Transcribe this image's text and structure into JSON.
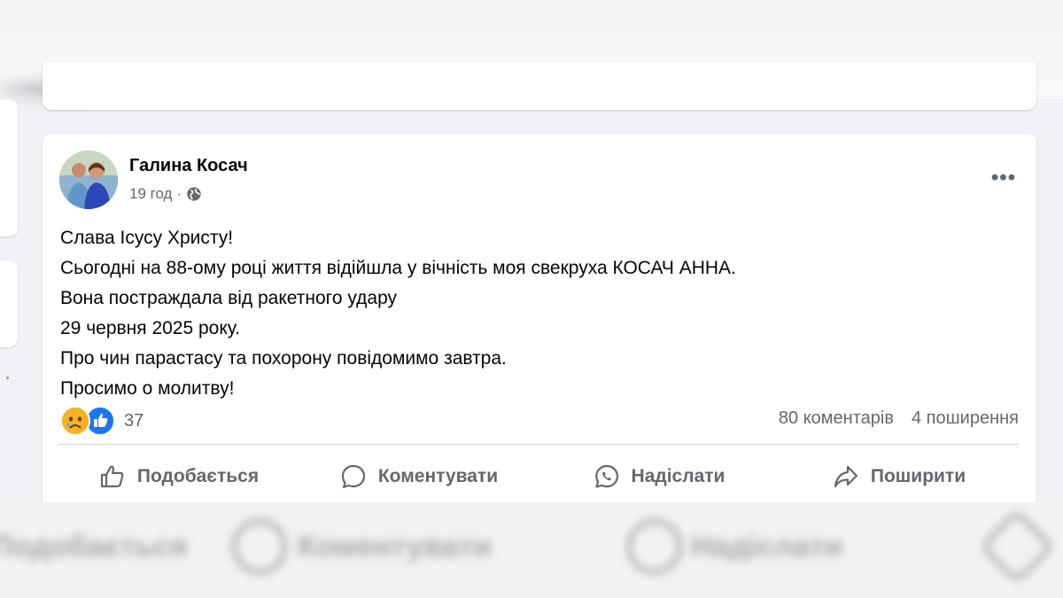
{
  "post": {
    "author": "Галина Косач",
    "time": "19 год",
    "separator": "·",
    "audience_icon": "globe-icon",
    "more_label": "•••",
    "text_lines": [
      "Слава Ісусу Христу!",
      "Сьогодні на 88-ому році життя відійшла у вічність моя свекруха КОСАЧ АННА.",
      "Вона постраждала від ракетного удару",
      "29 червня 2025 року.",
      "Про чин парастасу та похорону повідомимо завтра.",
      "Просимо о молитву!"
    ],
    "reactions": {
      "icons": [
        "sad-reaction-icon",
        "like-reaction-icon"
      ],
      "count": "37"
    },
    "comments": "80 коментарів",
    "shares": "4 поширення",
    "actions": {
      "like": "Подобається",
      "comment": "Коментувати",
      "send": "Надіслати",
      "share": "Поширити"
    }
  },
  "colors": {
    "background": "#f0f2f5",
    "card": "#ffffff",
    "secondary_text": "#65676b",
    "like_blue": "#1877f2",
    "sad_yellow": "#f7b125"
  }
}
